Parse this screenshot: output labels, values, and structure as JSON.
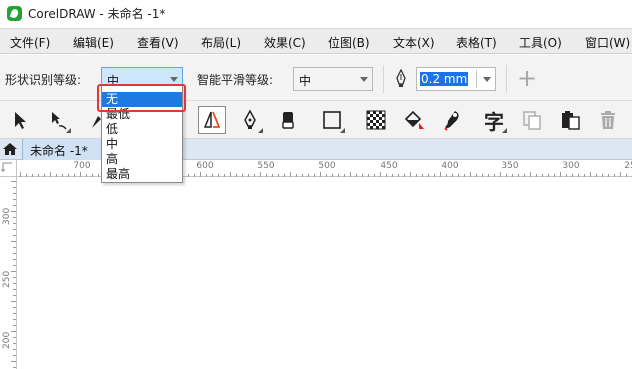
{
  "window": {
    "title": "CorelDRAW - 未命名 -1*"
  },
  "menu": {
    "items": [
      "文件(F)",
      "编辑(E)",
      "查看(V)",
      "布局(L)",
      "效果(C)",
      "位图(B)",
      "文本(X)",
      "表格(T)",
      "工具(O)",
      "窗口(W)"
    ]
  },
  "property_bar": {
    "shape_recognition_label": "形状识别等级:",
    "shape_recognition_value": "中",
    "smoothing_label": "智能平滑等级:",
    "smoothing_value": "中",
    "outline_width_value": "0.2 mm"
  },
  "dropdown": {
    "options": [
      "无",
      "最低",
      "低",
      "中",
      "高",
      "最高"
    ],
    "selected_index": 0
  },
  "document_tab": {
    "label": "未命名 -1*"
  },
  "ruler": {
    "horizontal_labels": [
      "700",
      "650",
      "600",
      "550",
      "500",
      "450",
      "400",
      "350",
      "300",
      "25"
    ],
    "vertical_labels": [
      "300",
      "250",
      "200"
    ]
  },
  "colors": {
    "selection_blue": "#1e7ae0",
    "highlight_red": "#e5353a",
    "tab_blue": "#cfe1f3"
  },
  "icons": [
    "pick-tool-icon",
    "shape-tool-icon",
    "freehand-tool-icon",
    "crop-tool-icon",
    "smart-drawing-tool-icon",
    "pen-tool-icon",
    "eraser-tool-icon",
    "rectangle-tool-icon",
    "pattern-fill-icon",
    "interactive-fill-icon",
    "color-eyedropper-icon",
    "text-tool-icon",
    "copy-properties-icon",
    "paste-icon",
    "delete-icon",
    "home-icon",
    "plus-icon"
  ]
}
